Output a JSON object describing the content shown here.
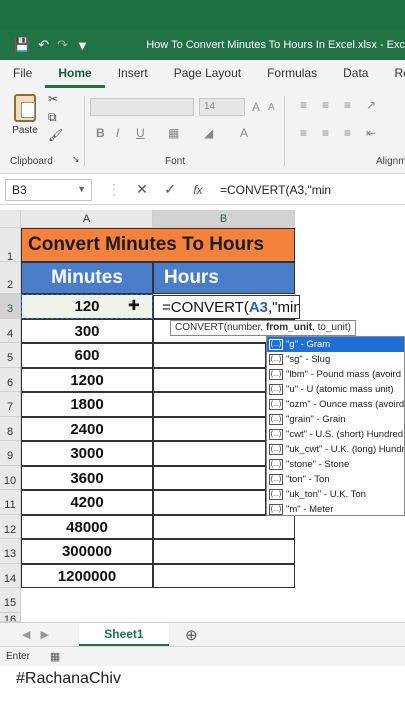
{
  "titlebar": {
    "title": "How To Convert Minutes To Hours In Excel.xlsx  -  Exc",
    "save_icon": "save-icon",
    "undo_icon": "undo-icon",
    "redo_icon": "redo-icon"
  },
  "ribbon_tabs": [
    "File",
    "Home",
    "Insert",
    "Page Layout",
    "Formulas",
    "Data",
    "Revie"
  ],
  "ribbon": {
    "paste_label": "Paste",
    "clipboard_label": "Clipboard",
    "font_label": "Font",
    "font_size": "14",
    "alignment_label": "Alignm",
    "bold": "B",
    "italic": "I",
    "underline": "U"
  },
  "formula_bar": {
    "name_box": "B3",
    "cancel": "✕",
    "enter": "✓",
    "fx": "fx",
    "formula": "=CONVERT(A3,\"min"
  },
  "columns": [
    "A",
    "B"
  ],
  "rows": [
    "1",
    "2",
    "3",
    "4",
    "5",
    "6",
    "7",
    "8",
    "9",
    "10",
    "11",
    "12",
    "13",
    "14",
    "15",
    "16"
  ],
  "sheet": {
    "title": "Convert Minutes To Hours",
    "header_minutes": "Minutes",
    "header_hours": "Hours",
    "minutes": [
      "120",
      "300",
      "600",
      "1200",
      "1800",
      "2400",
      "3000",
      "3600",
      "4200",
      "48000",
      "300000",
      "1200000"
    ]
  },
  "editing": {
    "prefix": "=CONVERT(",
    "ref": "A3",
    "suffix": ",\"min"
  },
  "tooltip": {
    "fn": "CONVERT(number, ",
    "arg_bold": "from_unit",
    "rest": ", to_unit)"
  },
  "dropdown_items": [
    "\"g\" - Gram",
    "\"sg\" - Slug",
    "\"lbm\" - Pound mass (avoird",
    "\"u\" - U (atomic mass unit)",
    "\"ozm\" - Ounce mass (avoird",
    "\"grain\" - Grain",
    "\"cwt\" - U.S. (short) Hundred",
    "\"uk_cwt\" - U.K. (long) Hundr",
    "\"stone\" - Stone",
    "\"ton\" - Ton",
    "\"uk_ton\" - U.K. Ton",
    "\"m\" - Meter"
  ],
  "sheet_tab": "Sheet1",
  "status": {
    "mode": "Enter"
  },
  "watermark": "#RachanaChiv"
}
